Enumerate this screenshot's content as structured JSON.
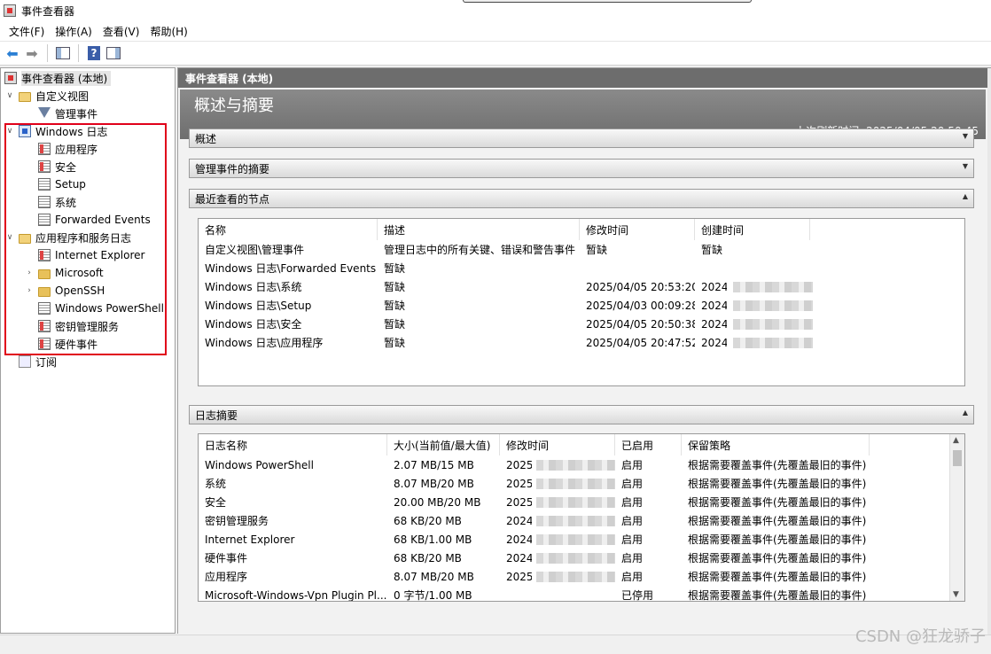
{
  "window": {
    "title": "事件查看器"
  },
  "menu": [
    "文件(F)",
    "操作(A)",
    "查看(V)",
    "帮助(H)"
  ],
  "tree": {
    "root": "事件查看器 (本地)",
    "custom_views": "自定义视图",
    "admin_events": "管理事件",
    "windows_logs": "Windows 日志",
    "windows_logs_children": [
      "应用程序",
      "安全",
      "Setup",
      "系统",
      "Forwarded Events"
    ],
    "app_service_logs": "应用程序和服务日志",
    "app_service_children": [
      "Internet Explorer",
      "Microsoft",
      "OpenSSH",
      "Windows PowerShell",
      "密钥管理服务",
      "硬件事件"
    ],
    "subscriptions": "订阅"
  },
  "right": {
    "header": "事件查看器 (本地)",
    "banner_title": "概述与摘要",
    "refresh_text": "上次刷新时间: 2025/04/05 20:50:45",
    "sections": {
      "overview": "概述",
      "admin_summary": "管理事件的摘要",
      "recent_nodes": "最近查看的节点",
      "log_summary": "日志摘要"
    }
  },
  "recent_table": {
    "headers": [
      "名称",
      "描述",
      "修改时间",
      "创建时间"
    ],
    "rows": [
      [
        "自定义视图\\管理事件",
        "管理日志中的所有关键、错误和警告事件",
        "暂缺",
        "暂缺"
      ],
      [
        "Windows 日志\\Forwarded Events",
        "暂缺",
        "",
        ""
      ],
      [
        "Windows 日志\\系统",
        "暂缺",
        "2025/04/05 20:53:20",
        "2024/("
      ],
      [
        "Windows 日志\\Setup",
        "暂缺",
        "2025/04/03 00:09:28",
        "2024/("
      ],
      [
        "Windows 日志\\安全",
        "暂缺",
        "2025/04/05 20:50:38",
        "2024/("
      ],
      [
        "Windows 日志\\应用程序",
        "暂缺",
        "2025/04/05 20:47:52",
        "2024/("
      ]
    ]
  },
  "log_table": {
    "headers": [
      "日志名称",
      "大小(当前值/最大值)",
      "修改时间",
      "已启用",
      "保留策略"
    ],
    "rows": [
      [
        "Windows PowerShell",
        "2.07 MB/15 MB",
        "2025/",
        "启用",
        "根据需要覆盖事件(先覆盖最旧的事件)"
      ],
      [
        "系统",
        "8.07 MB/20 MB",
        "2025/",
        "启用",
        "根据需要覆盖事件(先覆盖最旧的事件)"
      ],
      [
        "安全",
        "20.00 MB/20 MB",
        "2025/",
        "启用",
        "根据需要覆盖事件(先覆盖最旧的事件)"
      ],
      [
        "密钥管理服务",
        "68 KB/20 MB",
        "2024/",
        "启用",
        "根据需要覆盖事件(先覆盖最旧的事件)"
      ],
      [
        "Internet Explorer",
        "68 KB/1.00 MB",
        "2024/",
        "启用",
        "根据需要覆盖事件(先覆盖最旧的事件)"
      ],
      [
        "硬件事件",
        "68 KB/20 MB",
        "2024/",
        "启用",
        "根据需要覆盖事件(先覆盖最旧的事件)"
      ],
      [
        "应用程序",
        "8.07 MB/20 MB",
        "2025/",
        "启用",
        "根据需要覆盖事件(先覆盖最旧的事件)"
      ],
      [
        "Microsoft-Windows-Vpn Plugin Pl...",
        "0 字节/1.00 MB",
        "",
        "已停用",
        "根据需要覆盖事件(先覆盖最旧的事件)"
      ]
    ]
  },
  "watermark": "CSDN @狂龙骄子",
  "colors": {
    "highlight_box": "#e0001a",
    "header_bg": "#6d6d6d"
  }
}
